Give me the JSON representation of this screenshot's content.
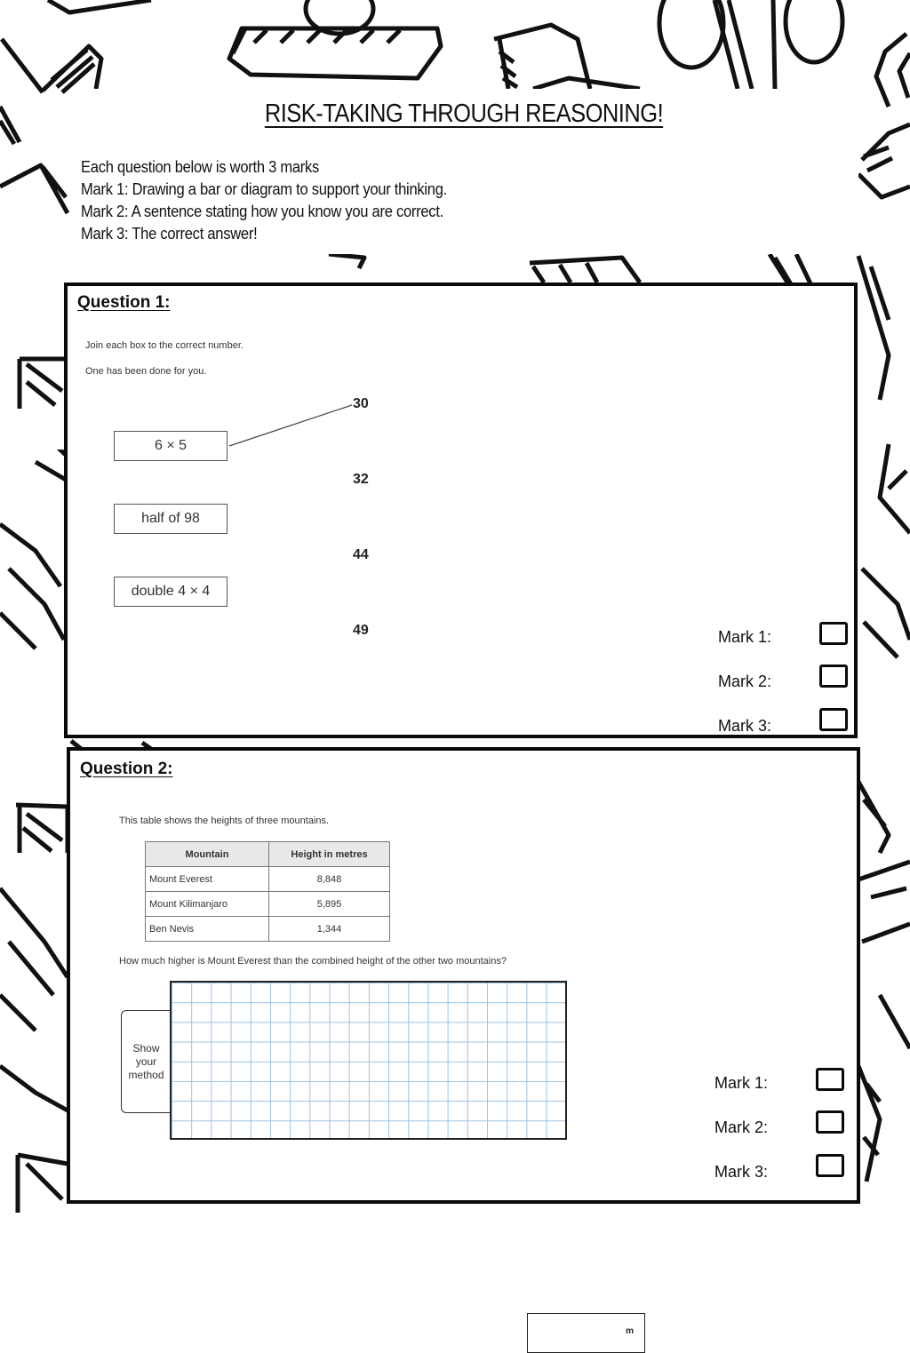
{
  "page": {
    "title": "RISK-TAKING THROUGH REASONING!",
    "rules": [
      "Each question below is worth 3 marks",
      "Mark 1: Drawing a bar or diagram to support your thinking.",
      "Mark 2: A sentence stating how you know you are correct.",
      "Mark 3: The correct answer!"
    ]
  },
  "question1": {
    "heading": "Question 1:",
    "instruction": "Join each box to the correct number.",
    "note": "One has been done for you.",
    "boxes": [
      "6 × 5",
      "half of 98",
      "double 4 × 4"
    ],
    "numbers": [
      "30",
      "32",
      "44",
      "49"
    ],
    "example_link": {
      "from": "6 × 5",
      "to": "30"
    },
    "marks": [
      "Mark 1:",
      "Mark 2:",
      "Mark 3:"
    ]
  },
  "question2": {
    "heading": "Question 2:",
    "intro": "This table shows the heights of three mountains.",
    "table": {
      "headers": [
        "Mountain",
        "Height in metres"
      ],
      "rows": [
        [
          "Mount Everest",
          "8,848"
        ],
        [
          "Mount Kilimanjaro",
          "5,895"
        ],
        [
          "Ben Nevis",
          "1,344"
        ]
      ]
    },
    "question": "How much higher is Mount Everest than the combined height of the other two mountains?",
    "method_label": [
      "Show",
      "your",
      "method"
    ],
    "answer_unit": "m",
    "marks": [
      "Mark 1:",
      "Mark 2:",
      "Mark 3:"
    ]
  }
}
